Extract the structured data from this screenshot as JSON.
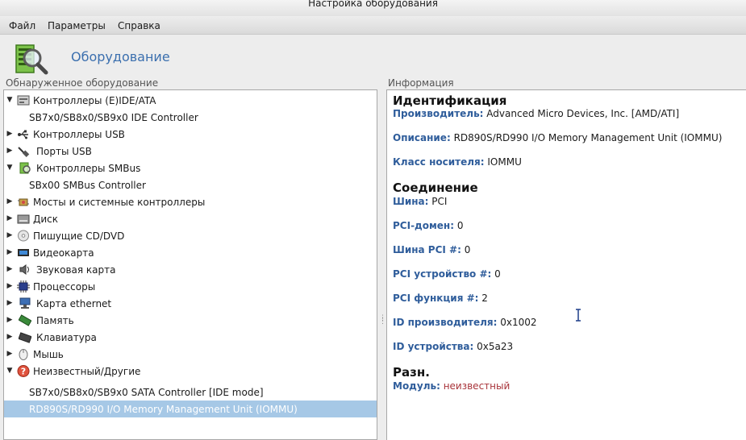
{
  "window": {
    "title": "Настройка оборудования"
  },
  "menu": [
    {
      "label": "Файл"
    },
    {
      "label": "Параметры"
    },
    {
      "label": "Справка"
    }
  ],
  "header": {
    "title": "Оборудование",
    "icon": "hardware-magnifier-icon"
  },
  "left_panel": {
    "label": "Обнаруженное оборудование",
    "items": [
      {
        "label": "Контроллеры (E)IDE/ATA",
        "level": 0,
        "expanded": true,
        "icon": "ide-controller-icon"
      },
      {
        "label": "SB7x0/SB8x0/SB9x0 IDE Controller",
        "level": 1
      },
      {
        "label": "Контроллеры USB",
        "level": 0,
        "expanded": false,
        "icon": "usb-icon"
      },
      {
        "label": "Порты USB",
        "level": 0,
        "expanded": false,
        "icon": "usb-port-icon"
      },
      {
        "label": "Контроллеры SMBus",
        "level": 0,
        "expanded": true,
        "icon": "smbus-icon"
      },
      {
        "label": "SBx00 SMBus Controller",
        "level": 1
      },
      {
        "label": "Мосты и системные контроллеры",
        "level": 0,
        "expanded": false,
        "icon": "bridge-icon"
      },
      {
        "label": "Диск",
        "level": 0,
        "expanded": false,
        "icon": "disk-icon"
      },
      {
        "label": "Пишущие CD/DVD",
        "level": 0,
        "expanded": false,
        "icon": "cd-icon"
      },
      {
        "label": "Видеокарта",
        "level": 0,
        "expanded": false,
        "icon": "video-card-icon"
      },
      {
        "label": "Звуковая карта",
        "level": 0,
        "expanded": false,
        "icon": "speaker-icon"
      },
      {
        "label": "Процессоры",
        "level": 0,
        "expanded": false,
        "icon": "cpu-icon"
      },
      {
        "label": "Карта ethernet",
        "level": 0,
        "expanded": false,
        "icon": "network-icon"
      },
      {
        "label": "Память",
        "level": 0,
        "expanded": false,
        "icon": "memory-icon"
      },
      {
        "label": "Клавиатура",
        "level": 0,
        "expanded": false,
        "icon": "keyboard-icon"
      },
      {
        "label": "Мышь",
        "level": 0,
        "expanded": false,
        "icon": "mouse-icon"
      },
      {
        "label": "Неизвестный/Другие",
        "level": 0,
        "expanded": true,
        "icon": "unknown-device-icon"
      },
      {
        "label": "SB7x0/SB8x0/SB9x0 SATA Controller [IDE mode]",
        "level": 1
      },
      {
        "label": "RD890S/RD990 I/O Memory Management Unit (IOMMU)",
        "level": 1,
        "selected": true
      }
    ]
  },
  "right_panel": {
    "label": "Информация",
    "identification": {
      "title": "Идентификация",
      "vendor_k": "Производитель:",
      "vendor_v": "Advanced Micro Devices, Inc. [AMD/ATI]",
      "desc_k": "Описание:",
      "desc_v": "RD890S/RD990 I/O Memory Management Unit (IOMMU)",
      "class_k": "Класс носителя:",
      "class_v": "IOMMU"
    },
    "connection": {
      "title": "Соединение",
      "bus_k": "Шина:",
      "bus_v": "PCI",
      "domain_k": "PCI-домен:",
      "domain_v": "0",
      "pcibus_k": "Шина PCI #:",
      "pcibus_v": "0",
      "device_k": "PCI устройство #:",
      "device_v": "0",
      "function_k": "PCI функция #:",
      "function_v": "2",
      "vendorid_k": "ID производителя:",
      "vendorid_v": "0x1002",
      "deviceid_k": "ID устройства:",
      "deviceid_v": "0x5a23"
    },
    "misc": {
      "title": "Разн.",
      "module_k": "Модуль:",
      "module_v": "неизвестный"
    }
  },
  "colors": {
    "accent": "#3b6fae",
    "key": "#2f5d9b",
    "selection": "#a6c8e6",
    "unknown_value": "#a8343a"
  }
}
